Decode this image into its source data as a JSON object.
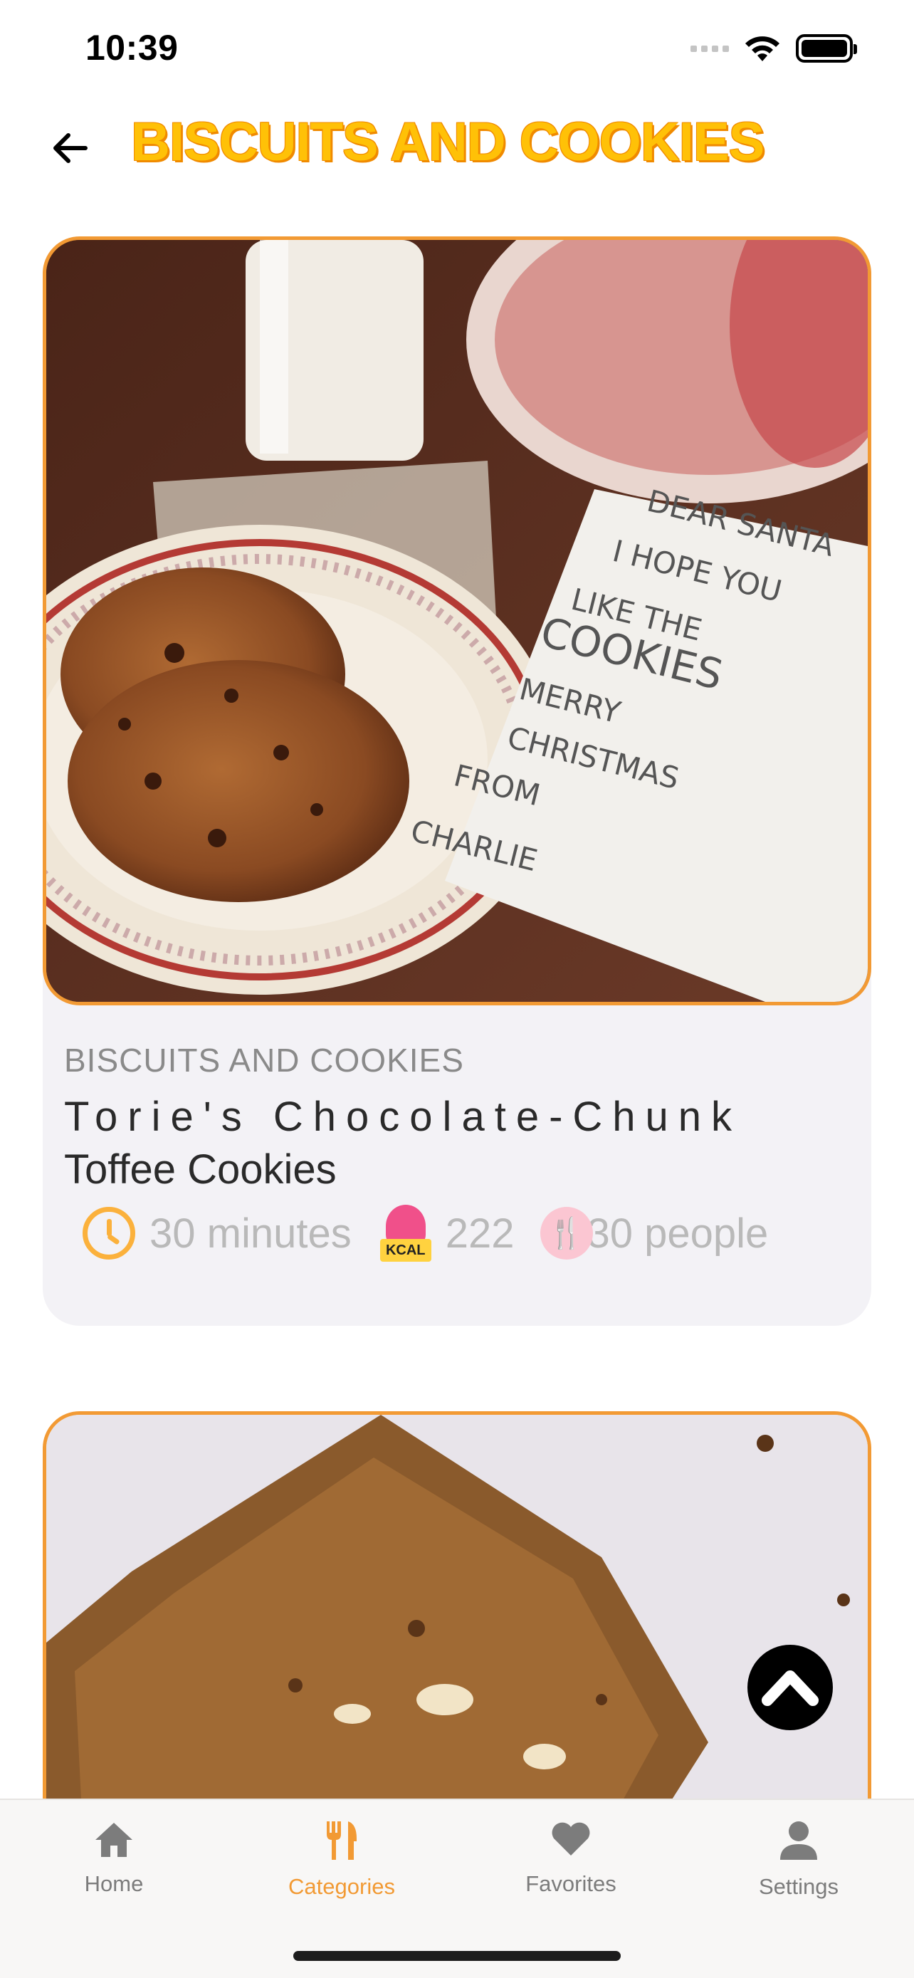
{
  "status_bar": {
    "time": "10:39"
  },
  "header": {
    "title": "BISCUITS AND COOKIES"
  },
  "recipes": [
    {
      "category": "BISCUITS AND COOKIES",
      "title_line1": "Torie's Chocolate-Chunk",
      "title_line2": "Toffee Cookies",
      "time": "30 minutes",
      "kcal": "222",
      "servings": "30 people",
      "image_note_lines": [
        "DEAR SANTA",
        "I HOPE YOU",
        "LIKE THE",
        "COOKIES",
        "MERRY",
        "CHRISTMAS",
        "FROM",
        "CHARLIE"
      ]
    },
    {
      "image": "granola-bar"
    }
  ],
  "kcal_badge": "KCAL",
  "tabs": [
    {
      "label": "Home",
      "icon": "home-icon",
      "active": false
    },
    {
      "label": "Categories",
      "icon": "utensils-icon",
      "active": true
    },
    {
      "label": "Favorites",
      "icon": "heart-icon",
      "active": false
    },
    {
      "label": "Settings",
      "icon": "user-icon",
      "active": false
    }
  ],
  "colors": {
    "accent": "#F29A34",
    "title": "#FFC107",
    "clock": "#FBB13C",
    "kcal": "#F0508A"
  }
}
